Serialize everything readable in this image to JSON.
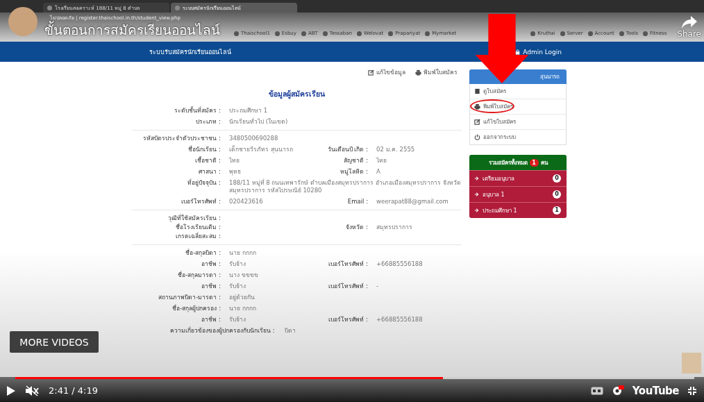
{
  "browser": {
    "tabs": [
      {
        "title": "โรงเรียนสงเคราะห์ 188/11 หมู่ 8 ตำบล",
        "selected": false
      },
      {
        "title": "ระบบสมัครนักเรียนออนไลน์",
        "selected": true
      }
    ],
    "address": "ไม่ปลอดภัย | register.thaischool.in.th/student_view.php",
    "bookmarks": [
      "Thaischool1",
      "Esbuy",
      "ABT",
      "Tessaban",
      "Welovat",
      "Prapariyat",
      "Mymarket",
      "Kruthai",
      "Server",
      "Account",
      "Tools",
      "Fitness"
    ]
  },
  "video_overlay": {
    "title": "ขั้นตอนการสมัครเรียนออนไลน์",
    "share": "Share",
    "more_videos": "MORE VIDEOS"
  },
  "navbar": {
    "brand": "ระบบรับสมัครนักเรียนออนไลน์",
    "admin_login": "Admin Login"
  },
  "actions": [
    {
      "kind": "edit",
      "label": "แก้ไขข้อมูล"
    },
    {
      "kind": "print",
      "label": "พิมพ์ใบสมัคร"
    }
  ],
  "form": {
    "heading": "ข้อมูลผู้สมัครเรียน",
    "sections": [
      [
        {
          "label": "ระดับชั้นที่สมัคร :",
          "value": "ประถมศึกษา 1"
        },
        {
          "label": "ประเภท :",
          "value": "นักเรียนทั่วไป (ในเขต)"
        }
      ],
      [
        {
          "label": "รหัสบัตรประจำตัวประชาชน :",
          "value": "3480500690288"
        },
        {
          "label": "ชื่อนักเรียน :",
          "value": "เด็กชายวีรภัทร สุนนารถ",
          "label_2": "วันเดือนปี เกิด :",
          "value_2": "02 ม.ค. 2555"
        },
        {
          "label": "เชื้อชาติ :",
          "value": "ไทย",
          "label_2": "สัญชาติ :",
          "value_2": "ไทย"
        },
        {
          "label": "ศาสนา :",
          "value": "พุทธ",
          "label_2": "หมู่โลหิต :",
          "value_2": "A"
        },
        {
          "label": "ที่อยู่ปัจจุบัน :",
          "value": "188/11 หมู่ที่ 8 ถนนเทพารักษ์ ตำบลเมืองสมุทรปราการ อำเภอเมืองสมุทรปราการ จังหวัดสมุทรปราการ รหัสไปรษณีย์ 10280"
        },
        {
          "label": "เบอร์โทรศัพท์ :",
          "value": "020423616",
          "label_2": "Email :",
          "value_2": "weerapat88@gmail.com"
        }
      ],
      [
        {
          "label": "วุฒิที่ใช้สมัครเรียน :"
        },
        {
          "label": "ชื่อโรงเรียนเดิม :",
          "label_2": "จังหวัด :",
          "value_2": "สมุทรปราการ"
        },
        {
          "label": "เกรดเฉลี่ยสะสม :"
        }
      ],
      [
        {
          "label": "ชื่อ-สกุลบิดา :",
          "value": "นาย กกกก"
        },
        {
          "label": "อาชีพ :",
          "value": "รับจ้าง",
          "label_2": "เบอร์โทรศัพท์ :",
          "value_2": "+66885556188"
        },
        {
          "label": "ชื่อ-สกุลมารดา :",
          "value": "นาง ขขขข"
        },
        {
          "label": "อาชีพ :",
          "value": "รับจ้าง",
          "label_2": "เบอร์โทรศัพท์ :",
          "value_2": "-"
        },
        {
          "label": "สถานภาพบิดา-มารดา :",
          "value": "อยู่ด้วยกัน"
        },
        {
          "label": "ชื่อ-สกุลผู้ปกครอง :",
          "value": "นาย กกกก"
        },
        {
          "label": "อาชีพ :",
          "value": "รับจ้าง",
          "label_2": "เบอร์โทรศัพท์ :",
          "value_2": "+66885556188"
        }
      ]
    ],
    "relationship": {
      "label": "ความเกี่ยวข้องของผู้ปกครองกับนักเรียน :",
      "value": "บิดา"
    }
  },
  "sidebar": {
    "header": "สุนนารถ",
    "items": [
      {
        "kind": "view",
        "label": "ดูใบสมัคร",
        "circled": false
      },
      {
        "kind": "print",
        "label": "พิมพ์ใบสมัคร",
        "circled": true
      },
      {
        "kind": "edit",
        "label": "แก้ไขใบสมัคร",
        "circled": false
      },
      {
        "kind": "logout",
        "label": "ออกจากระบบ",
        "circled": false
      }
    ]
  },
  "summary": {
    "title": "รวมสมัครทั้งหมด",
    "total": "1",
    "unit": "คน",
    "levels": [
      {
        "label": "เตรียมอนุบาล",
        "count": "0"
      },
      {
        "label": "อนุบาล 1",
        "count": "0"
      },
      {
        "label": "ประถมศึกษา 1",
        "count": "1"
      }
    ]
  },
  "player": {
    "level": 0.63,
    "muted": true,
    "time": "2:41 / 4:19",
    "logo": "YouTube"
  }
}
